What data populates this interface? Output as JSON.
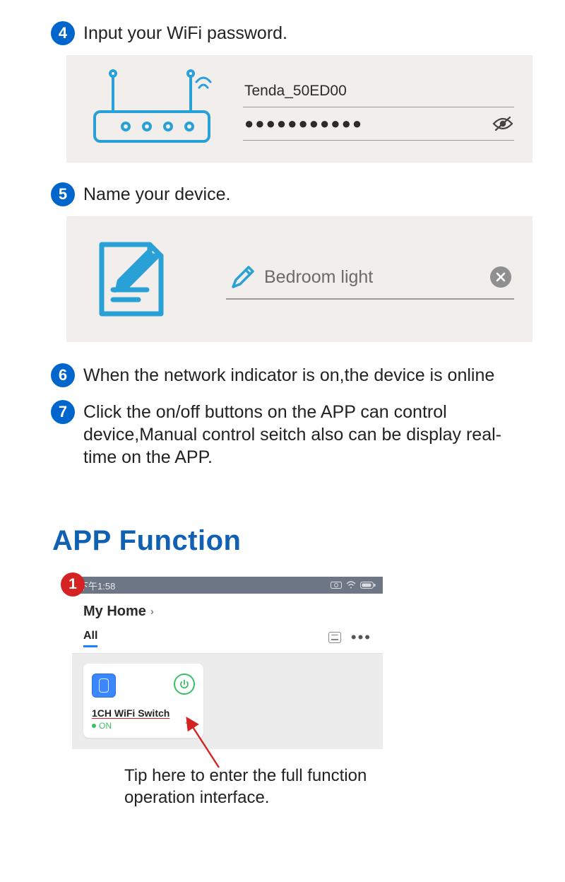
{
  "steps": {
    "s4": {
      "num": "4",
      "text": "Input your WiFi password."
    },
    "s5": {
      "num": "5",
      "text": "Name your device."
    },
    "s6": {
      "num": "6",
      "text": "When the network indicator is on,the device is online"
    },
    "s7": {
      "num": "7",
      "text": "Click the on/off buttons on the APP can control device,Manual control seitch also can be display real-time on the APP."
    }
  },
  "wifi": {
    "ssid": "Tenda_50ED00",
    "password_masked": "●●●●●●●●●●●"
  },
  "device_name_input": "Bedroom light",
  "section_heading": "APP Function",
  "app": {
    "badge": "1",
    "statusbar_time": "下午1:58",
    "home_title": "My Home",
    "tab_all": "All",
    "device_card": {
      "name": "1CH WiFi Switch",
      "status": "ON"
    },
    "tip": "Tip here to enter the full function operation interface."
  }
}
